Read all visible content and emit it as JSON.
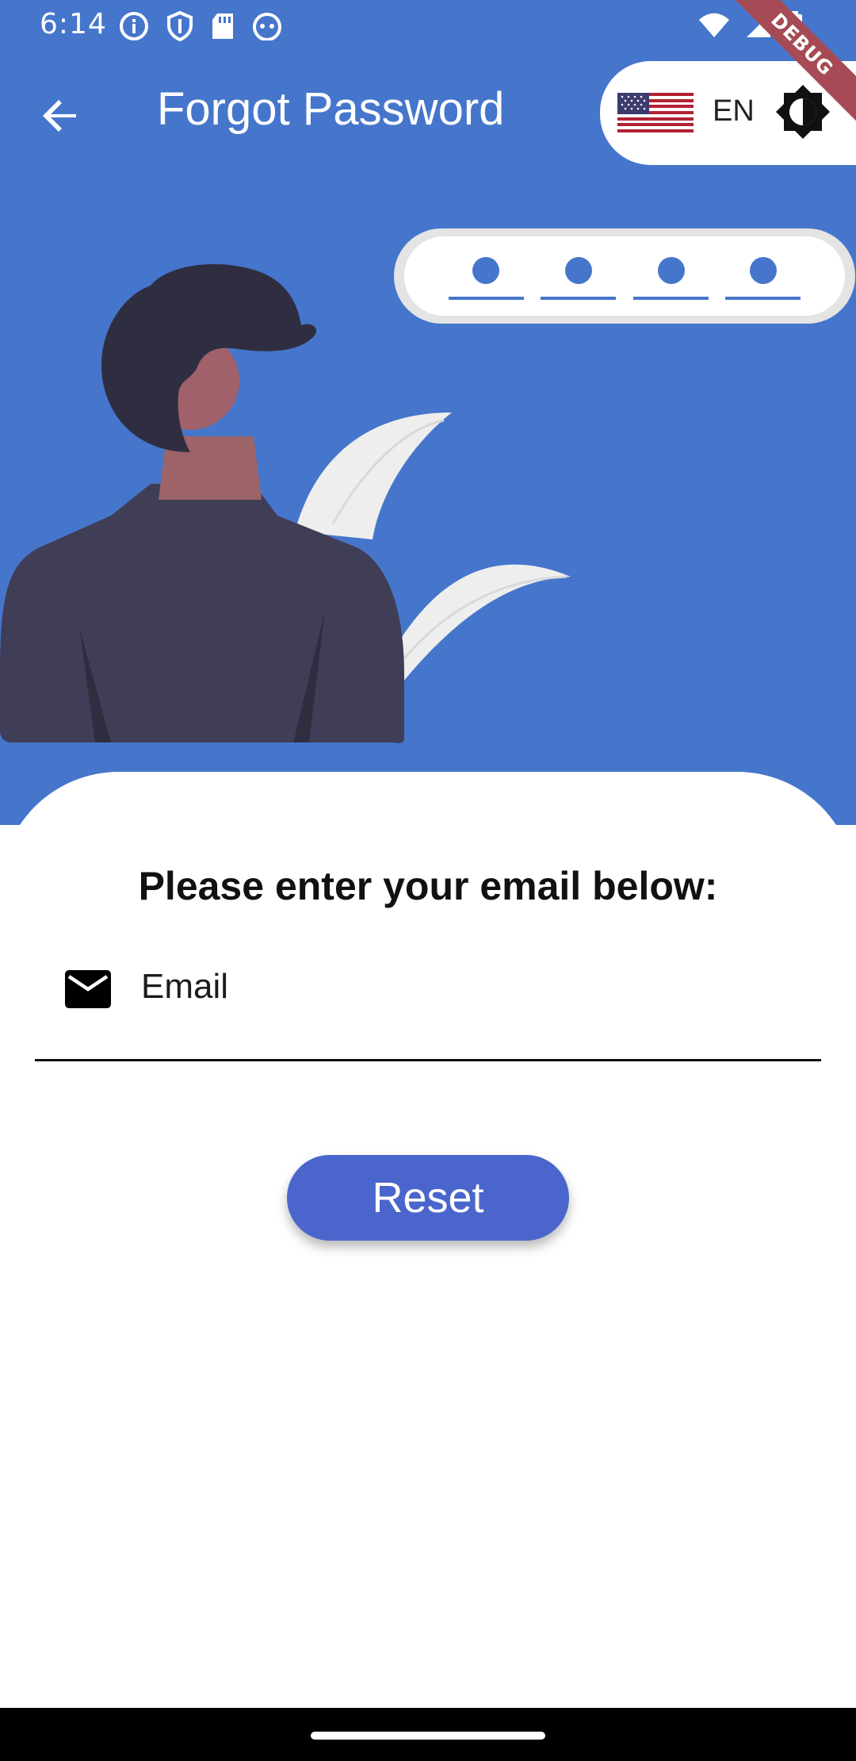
{
  "status_bar": {
    "time": "6:14",
    "left_icons": [
      "info-icon",
      "shield-icon",
      "sd-card-icon",
      "android-icon"
    ],
    "right_icons": [
      "wifi-icon",
      "signal-icon",
      "battery-icon"
    ]
  },
  "debug_banner": {
    "label": "DEBUG"
  },
  "app_bar": {
    "title": "Forgot Password",
    "back_icon": "arrow-back-icon"
  },
  "language": {
    "code": "EN",
    "flag": "us-flag-icon",
    "theme_icon": "brightness-icon"
  },
  "form": {
    "prompt": "Please enter your email below:",
    "email_placeholder": "Email",
    "email_value": "",
    "email_icon": "mail-icon",
    "reset_label": "Reset"
  },
  "colors": {
    "hero_background": "#4576CB",
    "button": "#4A66CC",
    "debug_ribbon": "#A64B55"
  }
}
